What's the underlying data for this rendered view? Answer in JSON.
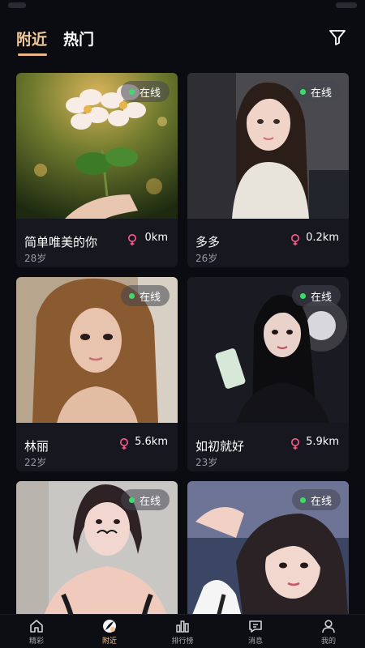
{
  "header": {
    "tabs": [
      {
        "label": "附近",
        "active": true
      },
      {
        "label": "热门",
        "active": false
      }
    ],
    "filter_icon": "filter-icon"
  },
  "online_label": "在线",
  "cards": [
    {
      "name": "简单唯美的你",
      "age": "28岁",
      "distance": "0km",
      "gender": "female",
      "online": true
    },
    {
      "name": "多多",
      "age": "26岁",
      "distance": "0.2km",
      "gender": "female",
      "online": true
    },
    {
      "name": "林丽",
      "age": "22岁",
      "distance": "5.6km",
      "gender": "female",
      "online": true
    },
    {
      "name": "如初就好",
      "age": "23岁",
      "distance": "5.9km",
      "gender": "female",
      "online": true
    },
    {
      "name": "",
      "age": "",
      "distance": "",
      "gender": "female",
      "online": true
    },
    {
      "name": "",
      "age": "",
      "distance": "",
      "gender": "female",
      "online": true
    }
  ],
  "bottom_nav": [
    {
      "label": "精彩",
      "icon": "home-icon",
      "active": false
    },
    {
      "label": "附近",
      "icon": "nearby-icon",
      "active": true
    },
    {
      "label": "排行榜",
      "icon": "ranking-icon",
      "active": false
    },
    {
      "label": "消息",
      "icon": "message-icon",
      "active": false
    },
    {
      "label": "我的",
      "icon": "profile-icon",
      "active": false
    }
  ],
  "colors": {
    "background": "#0b0b12",
    "card": "#17171f",
    "accent": "#f0c89a",
    "online_dot": "#3ddc6a",
    "female_icon": "#ff5a8a"
  }
}
